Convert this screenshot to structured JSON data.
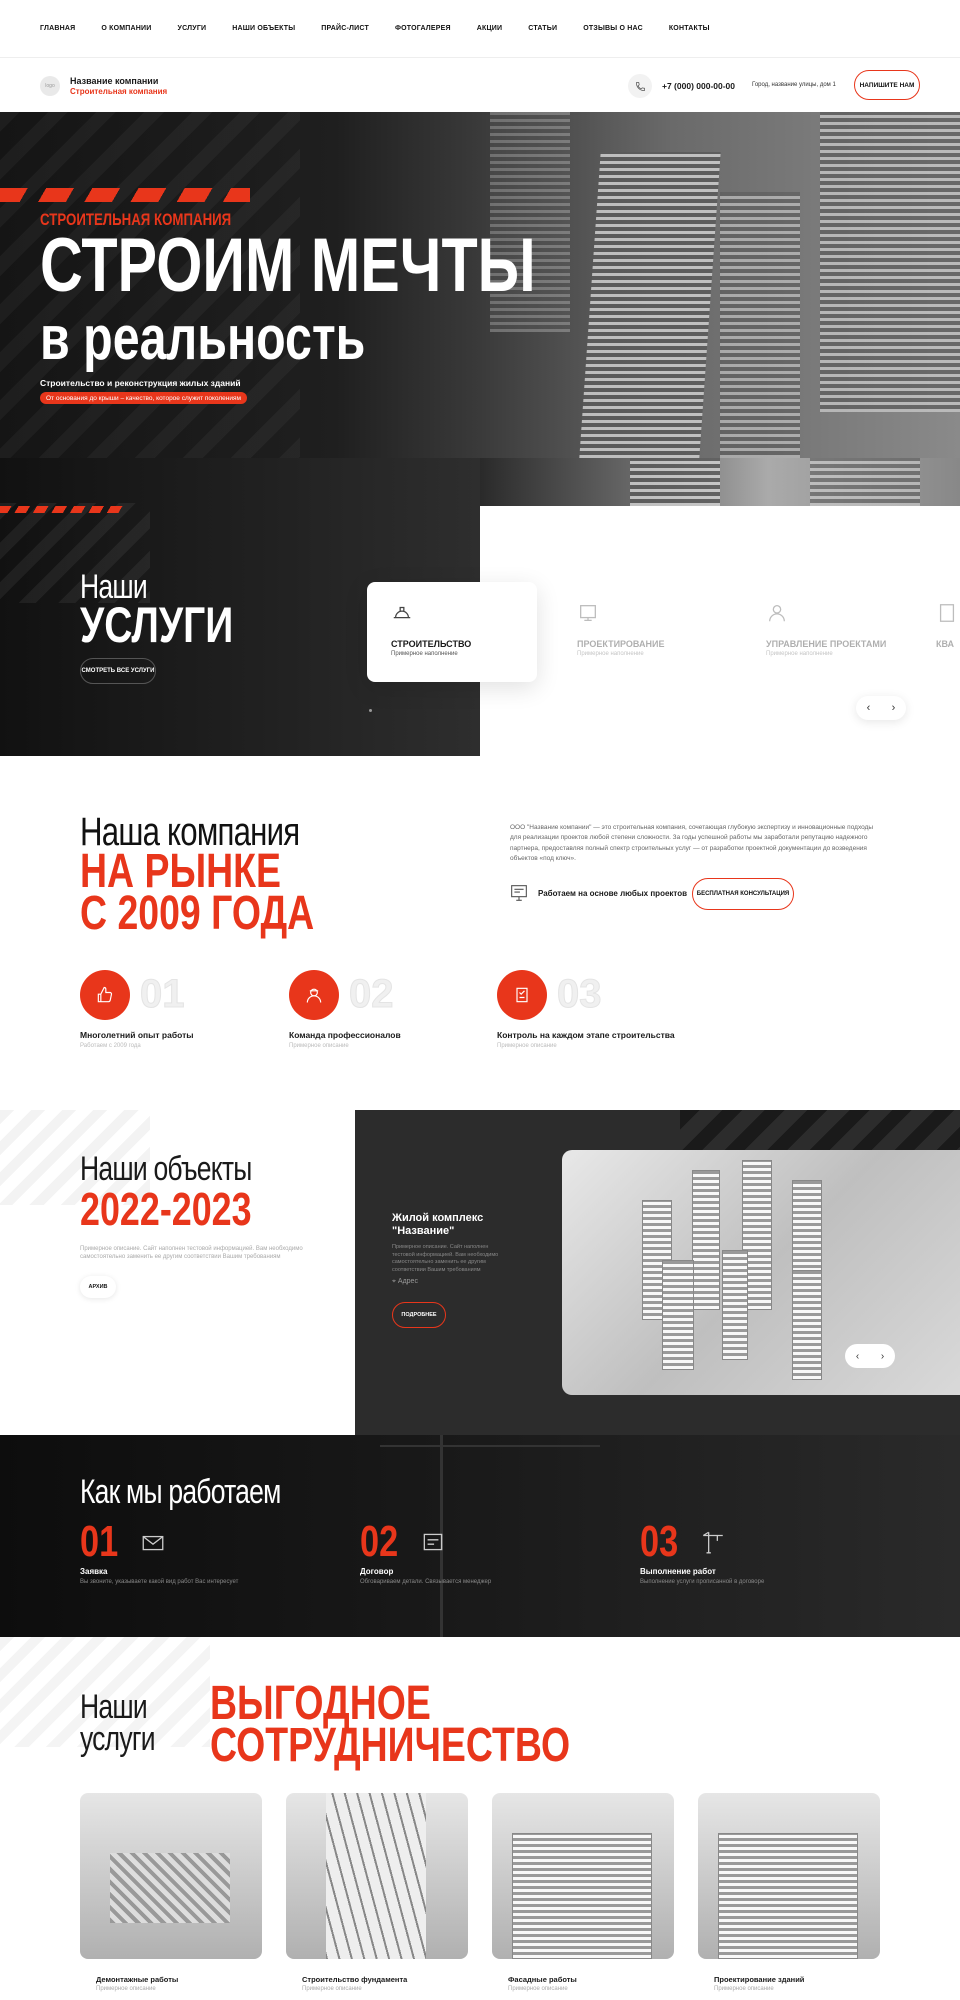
{
  "nav": [
    "ГЛАВНАЯ",
    "О КОМПАНИИ",
    "УСЛУГИ",
    "НАШИ ОБЪЕКТЫ",
    "ПРАЙС-ЛИСТ",
    "ФОТОГАЛЕРЕЯ",
    "АКЦИИ",
    "СТАТЬИ",
    "ОТЗЫВЫ О НАС",
    "КОНТАКТЫ"
  ],
  "header": {
    "logo": "logo",
    "company_name": "Название компании",
    "company_sub": "Строительная компания",
    "phone": "+7 (000) 000-00-00",
    "address": "Город, название улицы, дом 1",
    "write_btn": "НАПИШИТЕ НАМ"
  },
  "hero": {
    "kicker": "СТРОИТЕЛЬНАЯ КОМПАНИЯ",
    "title_1": "СТРОИМ МЕЧТЫ",
    "title_2": "в реальность",
    "desc": "Строительство и реконструкция жилых зданий",
    "badge": "От основания до крыши – качество, которое служит поколениям"
  },
  "services": {
    "title_1": "Наши",
    "title_2": "УСЛУГИ",
    "all_btn": "СМОТРЕТЬ ВСЕ УСЛУГИ",
    "cards": [
      {
        "title": "СТРОИТЕЛЬСТВО",
        "sub": "Примерное наполнение",
        "icon": "helmet-icon"
      },
      {
        "title": "ПРОЕКТИРОВАНИЕ",
        "sub": "Примерное наполнение",
        "icon": "blueprint-icon"
      },
      {
        "title": "УПРАВЛЕНИЕ ПРОЕКТАМИ",
        "sub": "Примерное наполнение",
        "icon": "manager-icon"
      },
      {
        "title": "КВА",
        "sub": "",
        "icon": "doc-icon"
      }
    ]
  },
  "company": {
    "title_1": "Наша компания",
    "title_2": "НА РЫНКЕ",
    "title_3": "С 2009 ГОДА",
    "text": "ООО \"Название компании\" — это строительная компания, сочетающая глубокую экспертизу и инновационные подходы для реализации проектов любой степени сложности. За годы успешной работы мы заработали репутацию надежного партнера, предоставляя полный спектр строительных услуг — от разработки проектной документации до возведения объектов «под ключ».",
    "projects_label": "Работаем на основе любых проектов",
    "consult_btn": "БЕСПЛАТНАЯ КОНСУЛЬТАЦИЯ",
    "features": [
      {
        "num": "01",
        "title": "Многолетний опыт работы",
        "sub": "Работаем с 2009 года"
      },
      {
        "num": "02",
        "title": "Команда профессионалов",
        "sub": "Примерное описание"
      },
      {
        "num": "03",
        "title": "Контроль на каждом этапе строительства",
        "sub": "Примерное описание"
      }
    ]
  },
  "objects": {
    "title_1": "Наши объекты",
    "title_2": "2022-2023",
    "desc": "Примерное описание. Сайт наполнен тестовой информацией. Вам необходимо самостоятельно заменить ее другим соответствии Вашим требованиям",
    "archive_btn": "АРХИВ",
    "name_1": "Жилой комплекс",
    "name_2": "\"Название\"",
    "obj_desc": "Примерное описание. Сайт наполнен тестовой информацией. Вам необходимо самостоятельно заменить ее другим соответствии Вашим требованиям",
    "address": "Адрес",
    "more_btn": "ПОДРОБНЕЕ"
  },
  "how": {
    "title": "Как мы работаем",
    "steps": [
      {
        "num": "01",
        "title": "Заявка",
        "sub": "Вы звоните, указываете какой вид работ Вас интересует"
      },
      {
        "num": "02",
        "title": "Договор",
        "sub": "Обговариваем детали. Связывается менеджер"
      },
      {
        "num": "03",
        "title": "Выполнение работ",
        "sub": "Выполнение услуги прописанной в договоре"
      }
    ]
  },
  "benefits": {
    "title_1": "Наши",
    "title_2": "услуги",
    "title_3": "ВЫГОДНОЕ",
    "title_4": "СОТРУДНИЧЕСТВО",
    "tiles": [
      {
        "title": "Демонтажные работы",
        "sub": "Примерное описание"
      },
      {
        "title": "Строительство фундамента",
        "sub": "Примерное описание"
      },
      {
        "title": "Фасадные работы",
        "sub": "Примерное описание"
      },
      {
        "title": "Проектирование зданий",
        "sub": "Примерное описание"
      }
    ]
  },
  "colors": {
    "accent": "#e8361b",
    "dark": "#1f1f1f"
  }
}
